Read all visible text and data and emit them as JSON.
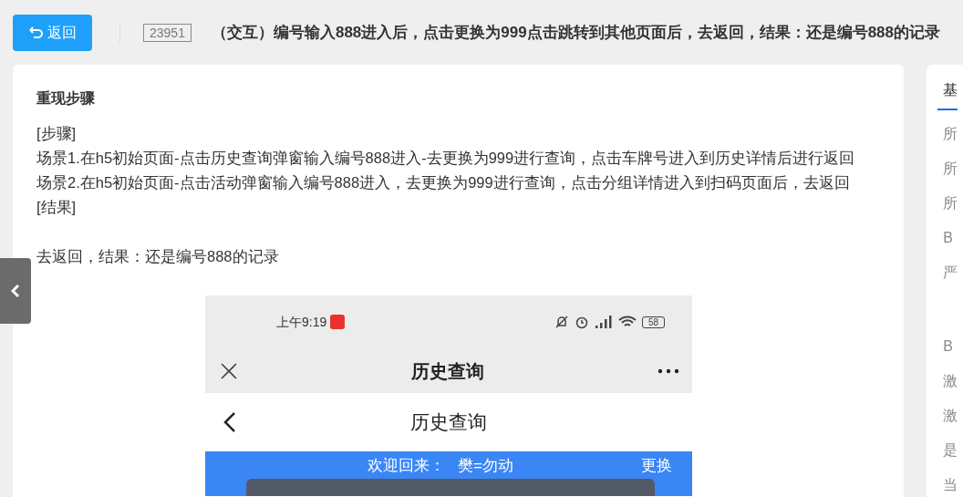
{
  "header": {
    "back_button": "返回",
    "issue_id": "23951",
    "title": "（交互）编号输入888进入后，点击更换为999点击跳转到其他页面后，去返回，结果：还是编号888的记录"
  },
  "main": {
    "section_title": "重现步骤",
    "lines": [
      "[步骤]",
      "场景1.在h5初始页面-点击历史查询弹窗输入编号888进入-去更换为999进行查询，点击车牌号进入到历史详情后进行返回",
      "场景2.在h5初始页面-点击活动弹窗输入编号888进入，去更换为999进行查询，点击分组详情进入到扫码页面后，去返回",
      "[结果]"
    ],
    "result_text": "去返回，结果：还是编号888的记录",
    "screenshot": {
      "status_time": "上午9:19",
      "battery": "58",
      "window_title": "历史查询",
      "page_title": "历史查询",
      "welcome_label": "欢迎回来：",
      "user_name": "樊=勿动",
      "change_link": "更换"
    }
  },
  "side_panel": {
    "tabs": [
      {
        "label": "基",
        "selected": true
      }
    ],
    "rows": [
      "所",
      "所",
      "所",
      "B",
      "严",
      "B",
      "激",
      "激",
      "是",
      "当"
    ]
  }
}
